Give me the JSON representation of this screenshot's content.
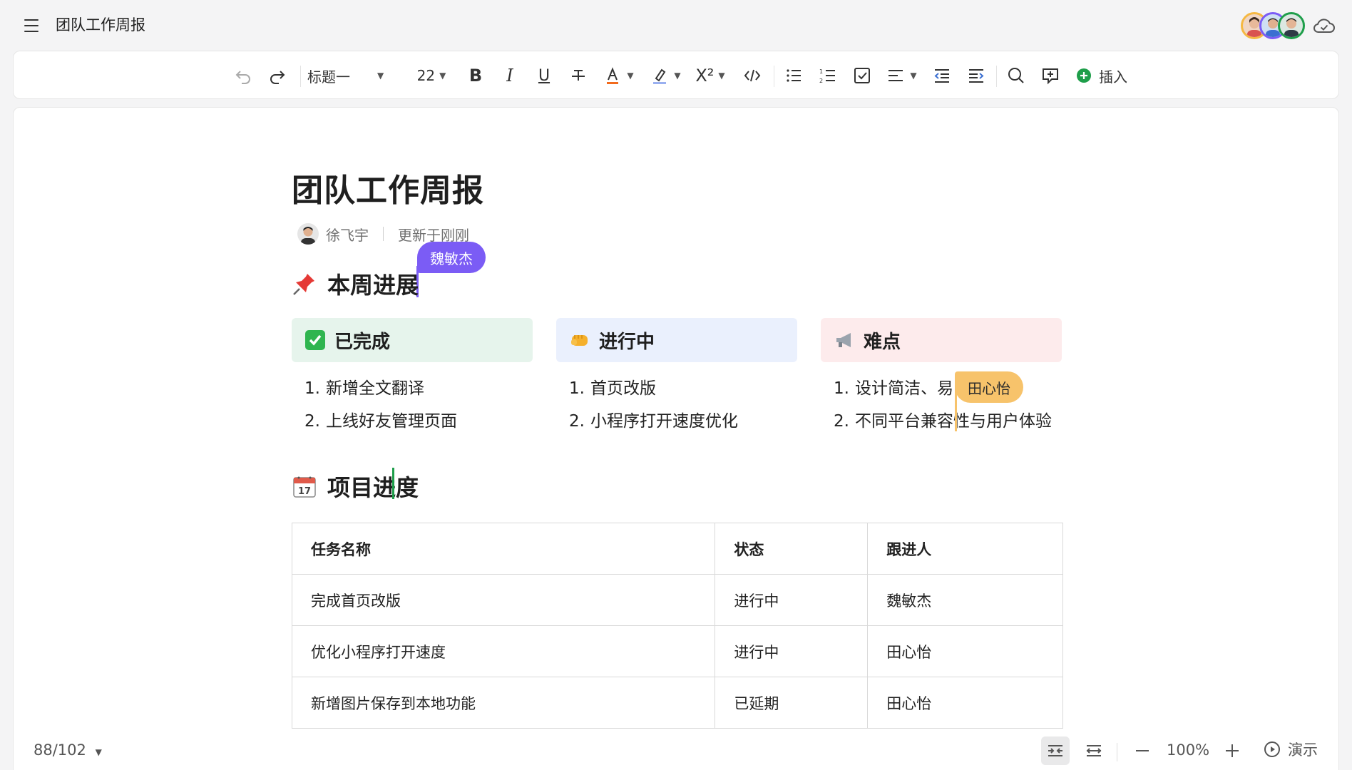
{
  "header": {
    "doc_title": "团队工作周报"
  },
  "toolbar": {
    "heading_style": "标题一",
    "font_size": "22",
    "bold_label": "B",
    "italic_label": "I",
    "underline_label": "U",
    "superscript_label": "X²",
    "insert_label": "插入",
    "accent_color": "#1e9e4a",
    "font_color": "#f26b1d"
  },
  "document": {
    "title": "团队工作周报",
    "author": "徐飞宇",
    "updated": "更新于刚刚",
    "section1": {
      "emoji": "pin-icon",
      "title": "本周进展"
    },
    "columns": [
      {
        "title": "已完成",
        "icon": "check-icon",
        "bg": "#e6f4ec",
        "items": [
          "新增全文翻译",
          "上线好友管理页面"
        ]
      },
      {
        "title": "进行中",
        "icon": "fist-icon",
        "bg": "#eaf0fd",
        "items": [
          "首页改版",
          "小程序打开速度优化"
        ]
      },
      {
        "title": "难点",
        "icon": "megaphone-icon",
        "bg": "#fdebec",
        "items": [
          "设计简洁、易",
          "不同平台兼容性与用户体验"
        ]
      }
    ],
    "section2": {
      "emoji": "calendar-icon",
      "title": "项目进度"
    },
    "table": {
      "headers": [
        "任务名称",
        "状态",
        "跟进人"
      ],
      "rows": [
        [
          "完成首页改版",
          "进行中",
          "魏敏杰"
        ],
        [
          "优化小程序打开速度",
          "进行中",
          "田心怡"
        ],
        [
          "新增图片保存到本地功能",
          "已延期",
          "田心怡"
        ]
      ]
    },
    "cursors": [
      {
        "name": "魏敏杰",
        "color": "#7b5cf5"
      },
      {
        "name": "田心怡",
        "color": "#f7c36b"
      },
      {
        "color": "#1e9e4a"
      }
    ]
  },
  "statusbar": {
    "word_count": "88/102",
    "zoom": "100%",
    "present_label": "演示"
  }
}
